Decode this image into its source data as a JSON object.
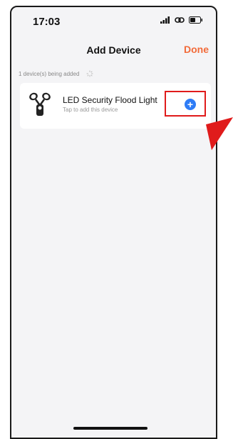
{
  "status_bar": {
    "time": "17:03"
  },
  "nav": {
    "title": "Add Device",
    "done_label": "Done"
  },
  "section": {
    "label": "1 device(s) being added"
  },
  "device": {
    "name": "LED Security Flood Light",
    "subtitle": "Tap to add this device"
  },
  "colors": {
    "accent_orange": "#f26b3a",
    "add_blue": "#2e7cf6",
    "callout_red": "#e01b1b"
  },
  "icons": [
    "signal-icon",
    "link-icon",
    "battery-icon",
    "loading-spinner-icon",
    "flood-light-icon",
    "add-circle-icon",
    "callout-arrow-icon"
  ]
}
